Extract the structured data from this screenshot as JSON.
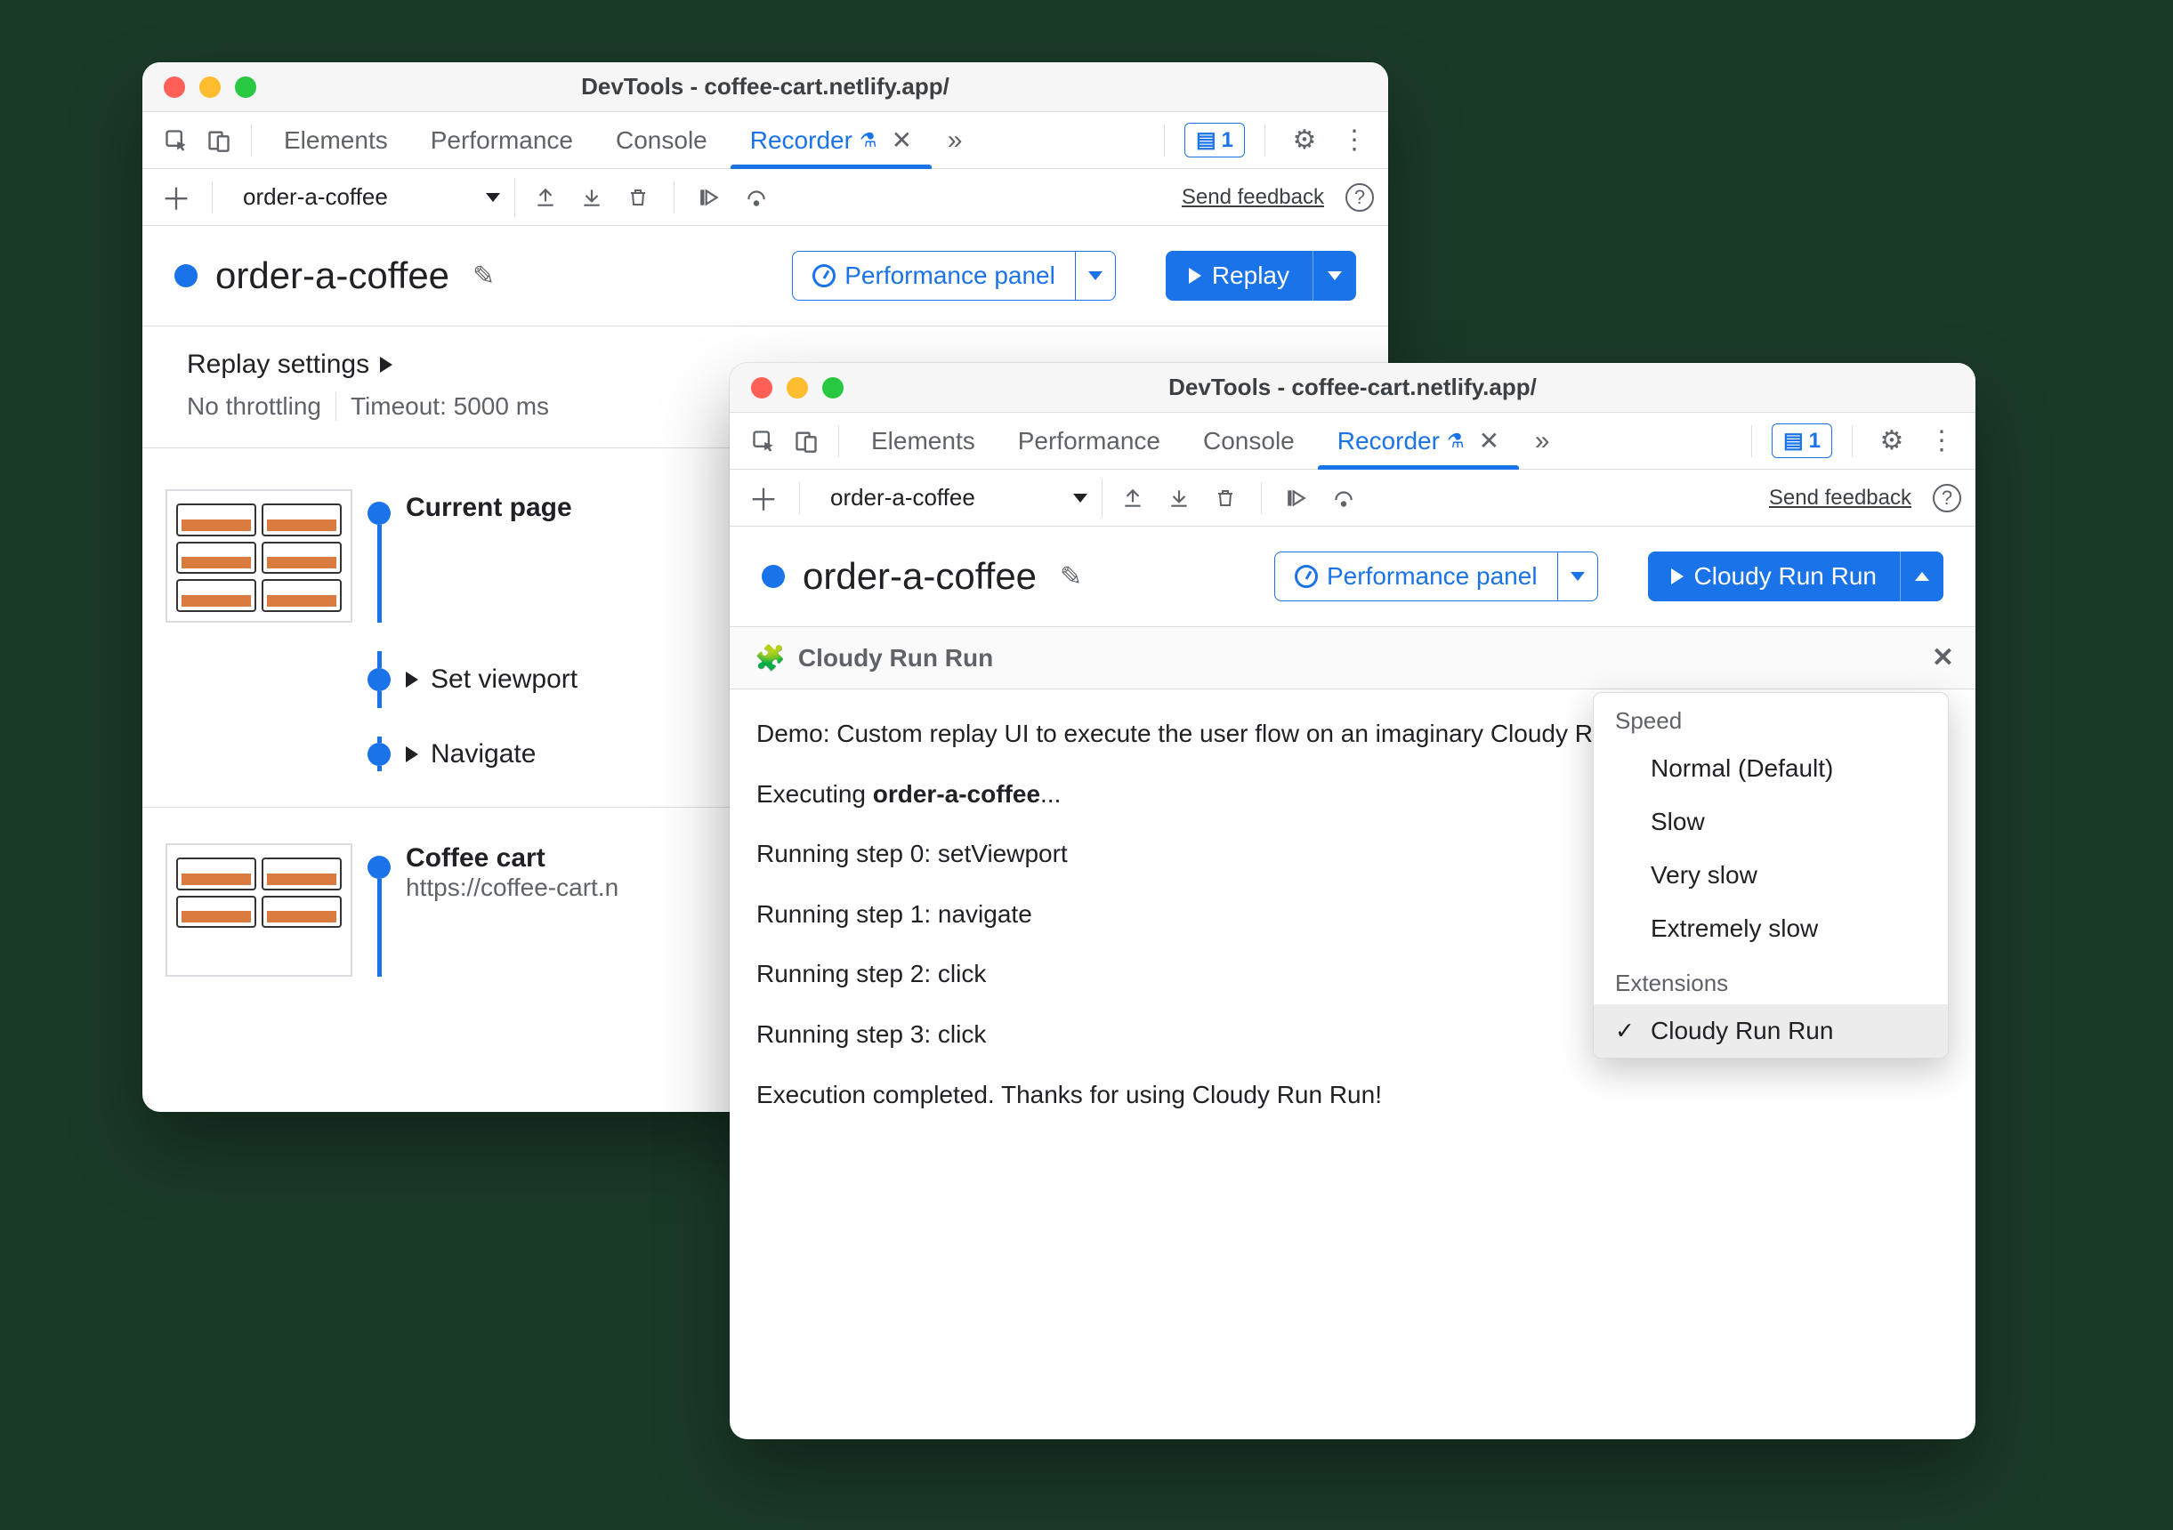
{
  "window_back": {
    "title": "DevTools - coffee-cart.netlify.app/",
    "tabs": [
      "Elements",
      "Performance",
      "Console",
      "Recorder"
    ],
    "badge_count": "1",
    "recording_selector": "order-a-coffee",
    "feedback": "Send feedback",
    "recording_title": "order-a-coffee",
    "perf_button": "Performance panel",
    "replay_button": "Replay",
    "replay_settings_label": "Replay settings",
    "throttling": "No throttling",
    "timeout": "Timeout: 5000 ms",
    "steps": {
      "s0": "Current page",
      "s1": "Set viewport",
      "s2": "Navigate",
      "s3_title": "Coffee cart",
      "s3_sub": "https://coffee-cart.n"
    }
  },
  "window_front": {
    "title": "DevTools - coffee-cart.netlify.app/",
    "tabs": [
      "Elements",
      "Performance",
      "Console",
      "Recorder"
    ],
    "badge_count": "1",
    "recording_selector": "order-a-coffee",
    "feedback": "Send feedback",
    "recording_title": "order-a-coffee",
    "perf_button": "Performance panel",
    "replay_button": "Cloudy Run Run",
    "panel_name": "Cloudy Run Run",
    "demo_text_a": "Demo: Custom replay UI to execute the user flow on an imaginary Cloudy Run Run platform.",
    "exec_prefix": "Executing ",
    "exec_target": "order-a-coffee",
    "exec_suffix": "...",
    "line0": "Running step 0: setViewport",
    "line1": "Running step 1: navigate",
    "line2": "Running step 2: click",
    "line3": "Running step 3: click",
    "done": "Execution completed. Thanks for using Cloudy Run Run!",
    "menu": {
      "hdr1": "Speed",
      "i1": "Normal (Default)",
      "i2": "Slow",
      "i3": "Very slow",
      "i4": "Extremely slow",
      "hdr2": "Extensions",
      "i5": "Cloudy Run Run"
    }
  }
}
